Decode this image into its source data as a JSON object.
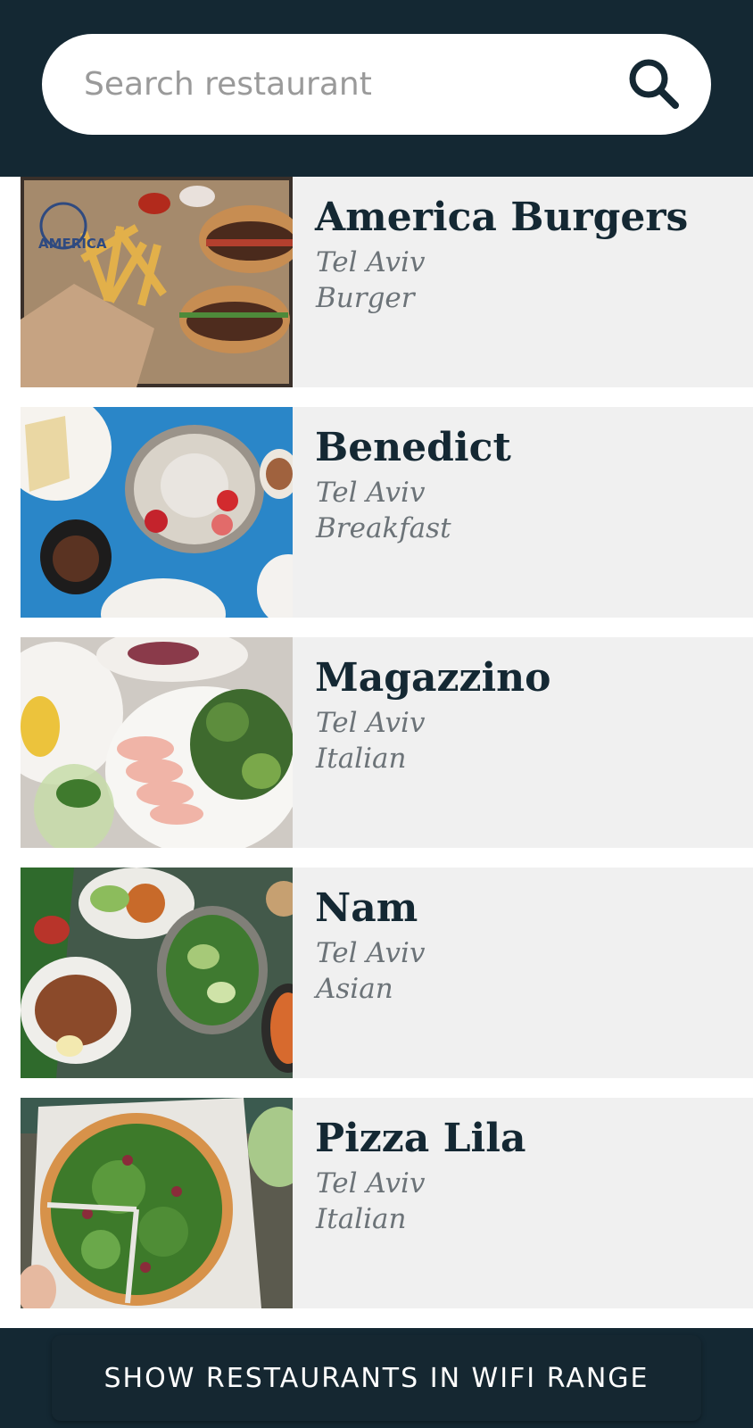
{
  "header": {
    "search_placeholder": "Search restaurant",
    "search_icon": "search-icon"
  },
  "restaurants": [
    {
      "name": "America Burgers",
      "city": "Tel Aviv",
      "cuisine": "Burger",
      "image": "burger-and-fries-photo"
    },
    {
      "name": "Benedict",
      "city": "Tel Aviv",
      "cuisine": "Breakfast",
      "image": "pancake-breakfast-photo"
    },
    {
      "name": "Magazzino",
      "city": "Tel Aviv",
      "cuisine": "Italian",
      "image": "salad-and-pasta-photo"
    },
    {
      "name": "Nam",
      "city": "Tel Aviv",
      "cuisine": "Asian",
      "image": "asian-dishes-photo"
    },
    {
      "name": "Pizza Lila",
      "city": "Tel Aviv",
      "cuisine": "Italian",
      "image": "arugula-pizza-photo"
    }
  ],
  "footer": {
    "button_label": "SHOW RESTAURANTS IN WIFI RANGE"
  },
  "colors": {
    "header_bg": "#142833",
    "card_bg": "#f0f0f0",
    "title_text": "#142833",
    "meta_text": "#6c7378"
  }
}
